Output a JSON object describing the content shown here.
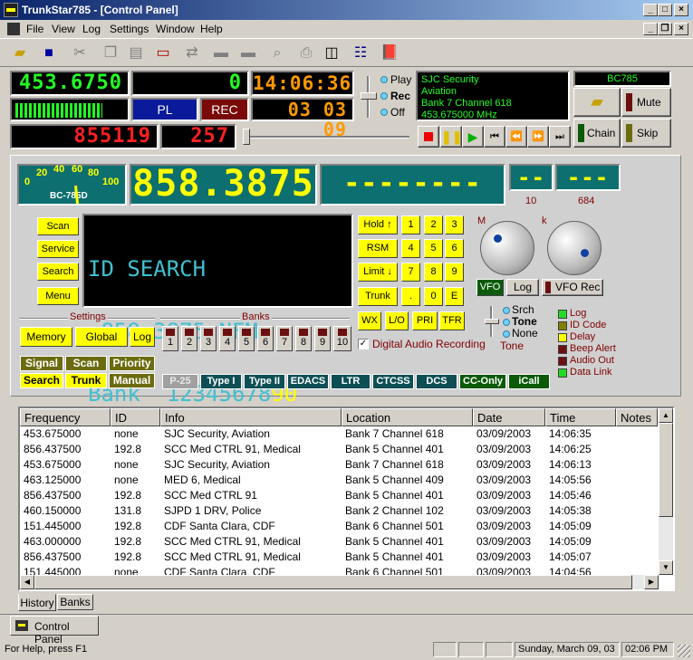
{
  "window": {
    "title": "TrunkStar785 - [Control Panel]"
  },
  "menu": [
    "File",
    "View",
    "Log",
    "Settings",
    "Window",
    "Help"
  ],
  "top_panel": {
    "freq": "453.6750",
    "counter": "0",
    "clock": "14:06:36",
    "date": "03 03 09",
    "id1": "855119",
    "id2": "257",
    "pl_label": "PL",
    "rec_label": "REC",
    "mode_options": [
      "Play",
      "Rec",
      "Off"
    ],
    "mode_selected": "Rec",
    "signal_level": 0.8,
    "info_lines": [
      "SJC Security",
      "Aviation",
      "Bank 7 Channel 618",
      "453.675000 MHz"
    ],
    "model": "BC785",
    "mute_label": "Mute",
    "chain_label": "Chain",
    "skip_label": "Skip"
  },
  "scanner": {
    "meter_scale": [
      "0",
      "20",
      "40",
      "60",
      "80",
      "100"
    ],
    "meter_label": "BC-785D",
    "big_freq": "858.3875",
    "dashes": "--------",
    "small1": "--",
    "small2": "---",
    "under1": "10",
    "under2": "684",
    "left_buttons": [
      "Scan",
      "Service",
      "Search",
      "Menu"
    ],
    "lcd_lines": [
      "ID SEARCH",
      " 858.3875 NFM",
      "Bank  12345678",
      "90"
    ],
    "keypad": [
      [
        "Hold ↑",
        "1",
        "2",
        "3"
      ],
      [
        "RSM",
        "4",
        "5",
        "6"
      ],
      [
        "Limit ↓",
        "7",
        "8",
        "9"
      ],
      [
        "Trunk",
        ".",
        "0",
        "E"
      ],
      [
        "WX",
        "L/O",
        "PRI",
        "TFR"
      ]
    ],
    "knob_labels": [
      "M",
      "k"
    ],
    "vfo_label": "VFO",
    "log_label": "Log",
    "vfo_rec_label": "VFO Rec",
    "settings_label": "Settings",
    "settings_buttons": [
      "Memory",
      "Global",
      "Log"
    ],
    "banks_label": "Banks",
    "banks": [
      "1",
      "2",
      "3",
      "4",
      "5",
      "6",
      "7",
      "8",
      "9",
      "10"
    ],
    "digital_label": "Digital Audio Recording",
    "digital_checked": true,
    "tone_options": [
      "Srch",
      "Tone",
      "None"
    ],
    "tone_label": "Tone",
    "mode_grid": [
      [
        "Signal",
        "Scan",
        "Priority"
      ],
      [
        "Search",
        "Trunk",
        "Manual"
      ]
    ],
    "systems": [
      "P-25",
      "Type I",
      "Type II",
      "EDACS",
      "LTR",
      "CTCSS",
      "DCS",
      "CC-Only",
      "iCall"
    ],
    "legend": [
      {
        "label": "Log",
        "color": "#22dd22"
      },
      {
        "label": "ID Code",
        "color": "#808000"
      },
      {
        "label": "Delay",
        "color": "#ffff00"
      },
      {
        "label": "Beep Alert",
        "color": "#6b1010"
      },
      {
        "label": "Audio Out",
        "color": "#6b1010"
      },
      {
        "label": "Data Link",
        "color": "#22dd22"
      }
    ]
  },
  "history": {
    "columns": [
      "Frequency",
      "ID",
      "Info",
      "Location",
      "Date",
      "Time",
      "Notes"
    ],
    "rows": [
      [
        "453.675000",
        "none",
        "SJC Security, Aviation",
        "Bank 7 Channel 618",
        "03/09/2003",
        "14:06:35"
      ],
      [
        "856.437500",
        "192.8",
        "SCC Med CTRL 91, Medical",
        "Bank 5 Channel 401",
        "03/09/2003",
        "14:06:25"
      ],
      [
        "453.675000",
        "none",
        "SJC Security, Aviation",
        "Bank 7 Channel 618",
        "03/09/2003",
        "14:06:13"
      ],
      [
        "463.125000",
        "none",
        "MED 6, Medical",
        "Bank 5 Channel 409",
        "03/09/2003",
        "14:05:56"
      ],
      [
        "856.437500",
        "192.8",
        "SCC Med CTRL 91",
        "Bank 5 Channel 401",
        "03/09/2003",
        "14:05:46"
      ],
      [
        "460.150000",
        "131.8",
        "SJPD 1 DRV, Police",
        "Bank 2 Channel 102",
        "03/09/2003",
        "14:05:38"
      ],
      [
        "151.445000",
        "192.8",
        "CDF Santa Clara, CDF",
        "Bank 6 Channel 501",
        "03/09/2003",
        "14:05:09"
      ],
      [
        "463.000000",
        "192.8",
        "SCC Med CTRL 91, Medical",
        "Bank 5 Channel 401",
        "03/09/2003",
        "14:05:09"
      ],
      [
        "856.437500",
        "192.8",
        "SCC Med CTRL 91, Medical",
        "Bank 5 Channel 401",
        "03/09/2003",
        "14:05:07"
      ],
      [
        "151.445000",
        "none",
        "CDF Santa Clara, CDF",
        "Bank 6 Channel 501",
        "03/09/2003",
        "14:04:56"
      ]
    ],
    "tabs": [
      "History",
      "Banks"
    ]
  },
  "doc_tab": "Control Panel",
  "status": {
    "help": "For Help, press F1",
    "date": "Sunday, March 09, 03",
    "time": "02:06 PM"
  }
}
